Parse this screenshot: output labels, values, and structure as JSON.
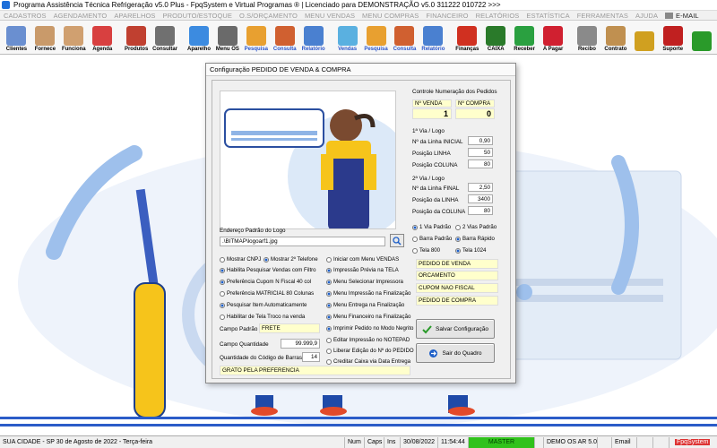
{
  "window": {
    "title": "Programa Assistência Técnica Refrigeração v5.0 Plus - FpqSystem e Virtual Programas ® | Licenciado para  DEMONSTRAÇÃO v5.0 311222 010722 >>>"
  },
  "menu": {
    "items": [
      "CADASTROS",
      "AGENDAMENTO",
      "APARELHOS",
      "PRODUTO/ESTOQUE",
      "O.S/ORÇAMENTO",
      "MENU VENDAS",
      "MENU COMPRAS",
      "FINANCEIRO",
      "RELATÓRIOS",
      "ESTATÍSTICA",
      "FERRAMENTAS",
      "AJUDA"
    ],
    "email": "E-MAIL"
  },
  "toolbar": {
    "items": [
      {
        "label": "Clientes",
        "icon": "clients-icon",
        "color": "#6a8fd0"
      },
      {
        "label": "Fornece",
        "icon": "supplier-icon",
        "color": "#c99a6a"
      },
      {
        "label": "Funciona",
        "icon": "employee-icon",
        "color": "#d0a070"
      },
      {
        "label": "Agenda",
        "icon": "calendar-icon",
        "color": "#d84040"
      },
      {
        "label": "Produtos",
        "icon": "products-icon",
        "color": "#c04030"
      },
      {
        "label": "Consultar",
        "icon": "consult-icon",
        "color": "#707070"
      },
      {
        "label": "Aparelho",
        "icon": "device-icon",
        "color": "#3c8be0"
      },
      {
        "label": "Menu OS",
        "icon": "os-menu-icon",
        "color": "#6a6a6a"
      },
      {
        "label": "Pesquisa",
        "icon": "search-icon",
        "color": "#e8a030"
      },
      {
        "label": "Consulta",
        "icon": "consulta-icon",
        "color": "#d06030"
      },
      {
        "label": "Relatório",
        "icon": "report-icon",
        "color": "#4a80d0"
      },
      {
        "label": "Vendas",
        "icon": "sales-icon",
        "color": "#5ab0e0"
      },
      {
        "label": "Pesquisa",
        "icon": "search2-icon",
        "color": "#e8a030"
      },
      {
        "label": "Consulta",
        "icon": "consulta2-icon",
        "color": "#d06030"
      },
      {
        "label": "Relatório",
        "icon": "report2-icon",
        "color": "#4a80d0"
      },
      {
        "label": "Finanças",
        "icon": "finance-icon",
        "color": "#d03020"
      },
      {
        "label": "CAIXA",
        "icon": "cashier-icon",
        "color": "#2a7a2a"
      },
      {
        "label": "Receber",
        "icon": "receive-icon",
        "color": "#2aa040"
      },
      {
        "label": "A Pagar",
        "icon": "pay-icon",
        "color": "#d02030"
      },
      {
        "label": "Recibo",
        "icon": "receipt-icon",
        "color": "#8a8a8a"
      },
      {
        "label": "Contrato",
        "icon": "contract-icon",
        "color": "#c09050"
      },
      {
        "label": "",
        "icon": "coins-icon",
        "color": "#d0a020"
      },
      {
        "label": "Suporte",
        "icon": "support-icon",
        "color": "#c02020"
      },
      {
        "label": "",
        "icon": "exit-icon",
        "color": "#2a9a2a"
      }
    ]
  },
  "dialog": {
    "title": "Configuração PEDIDO DE VENDA & COMPRA",
    "logo_label": "Endereço Padrão do Logo",
    "logo_path": ".\\BITMAP\\logoarf1.jpg",
    "numbering": {
      "title": "Controle Numeração dos Pedidos",
      "sale_label": "Nº VENDA",
      "purchase_label": "Nº COMPRA",
      "sale_value": "1",
      "purchase_value": "0"
    },
    "first_copy": {
      "title": "1ª Via / Logo",
      "rows": [
        {
          "label": "Nº da Linha INICIAL",
          "value": "0,90"
        },
        {
          "label": "Posição LINHA",
          "value": "50"
        },
        {
          "label": "Posição COLUNA",
          "value": "80"
        }
      ]
    },
    "second_copy": {
      "title": "2ª Via / Logo",
      "rows": [
        {
          "label": "Nº da Linha FINAL",
          "value": "2,50"
        },
        {
          "label": "Posição da LINHA",
          "value": "3400"
        },
        {
          "label": "Posição da COLUNA",
          "value": "80"
        }
      ]
    },
    "via_options": [
      {
        "label": "1 Via Padrão",
        "on": true
      },
      {
        "label": "2 Vias Padrão",
        "on": false
      },
      {
        "label": "Barra Padrão",
        "on": false
      },
      {
        "label": "Barra Rápido",
        "on": true
      },
      {
        "label": "Tela 800",
        "on": false
      },
      {
        "label": "Tela 1024",
        "on": true
      }
    ],
    "doc_titles": [
      "PEDIDO DE VENDA",
      "ORCAMENTO",
      "CUPOM NAO FISCAL",
      "PEDIDO DE COMPRA"
    ],
    "options_col1": [
      {
        "label": "Mostrar CNPJ",
        "on": false
      },
      {
        "label": "Habilita Pesquisar Vendas com Filtro",
        "on": true
      },
      {
        "label": "Preferência Cupom N Fiscal 40 col",
        "on": true
      },
      {
        "label": "Preferência MATRICIAL 80 Colunas",
        "on": false
      },
      {
        "label": "Pesquisar Item Automaticamente",
        "on": true
      },
      {
        "label": "Habilitar de Tela Troco na venda",
        "on": false
      }
    ],
    "show_phone": {
      "label": "Mostrar 2º Telefone",
      "on": true
    },
    "options_col2": [
      {
        "label": "Iniciar com Menu VENDAS",
        "on": false
      },
      {
        "label": "Impressão Prévia na TELA",
        "on": true
      },
      {
        "label": "Menu Selecionar Impressora",
        "on": true
      },
      {
        "label": "Menu Impressão na Finalização",
        "on": true
      },
      {
        "label": "Menu Entrega na Finalização",
        "on": true
      },
      {
        "label": "Menu Financeiro na Finalização",
        "on": true
      },
      {
        "label": "Imprimir Pedido no Modo Negrito",
        "on": true
      },
      {
        "label": "Editar Impressão no NOTEPAD",
        "on": false
      },
      {
        "label": "Liberar Edição do Nº do PEDIDO",
        "on": false
      },
      {
        "label": "Creditar Caixa via Data Entrega",
        "on": false
      }
    ],
    "default_field_label": "Campo Padrão",
    "default_field_value": "FRETE",
    "qty_label": "Campo Quantidade",
    "qty_value": "99.999,9",
    "barcode_label": "Quantidade do Código de Barras",
    "barcode_value": "14",
    "footer_msg": "GRATO PELA PREFERENCIA",
    "save_button": "Salvar Configuração",
    "exit_button": "Sair do Quadro"
  },
  "status": {
    "city": "SUA CIDADE - SP 30 de Agosto de 2022 - Terça-feira",
    "num": "Num",
    "caps": "Caps",
    "ins": "Ins",
    "date": "30/08/2022",
    "time": "11:54:44",
    "mode": "MASTER",
    "demo": "DEMO OS AR 5.0",
    "email": "Email",
    "brand": "FpqSystem"
  },
  "colors": {
    "accent": "#1d5fc8",
    "yellow_field": "#ffffcc",
    "master_green": "#31c21c"
  }
}
